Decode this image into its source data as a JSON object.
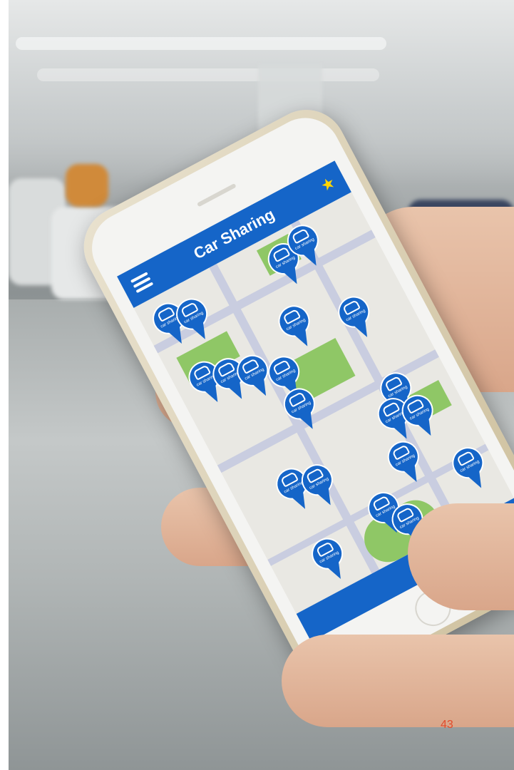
{
  "app": {
    "title": "Car Sharing",
    "pin_label": "car sharing",
    "accent_color": "#1565c8",
    "star_color": "#ffd400",
    "park_color": "#8fc766"
  },
  "icons": {
    "menu": "menu-icon",
    "favorite": "star-icon",
    "pin": "map-pin-icon",
    "car": "car-icon"
  },
  "page": {
    "number": "43"
  }
}
